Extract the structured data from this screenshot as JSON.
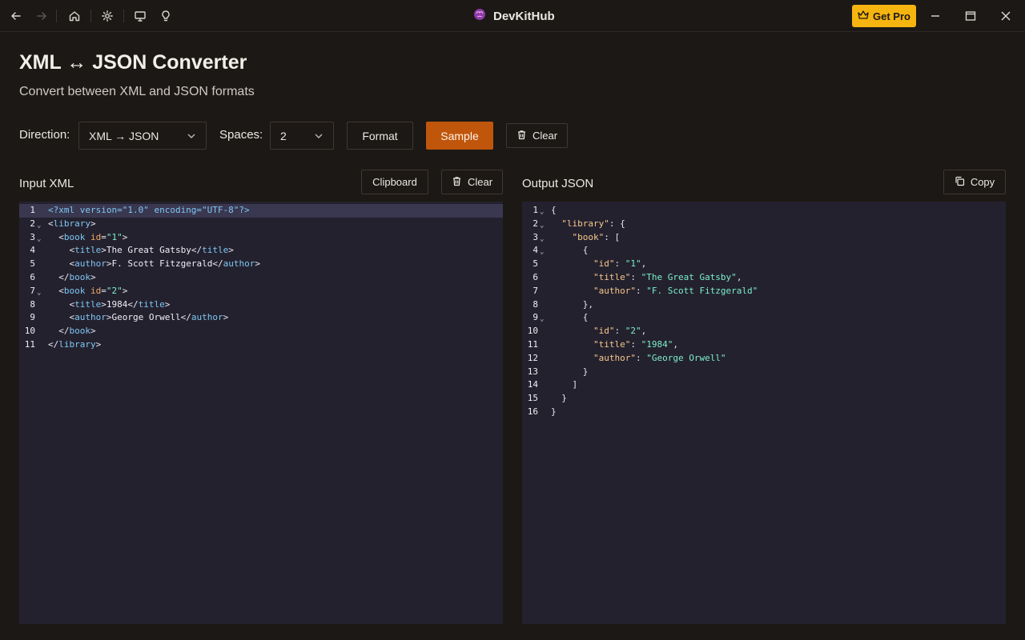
{
  "app": {
    "title": "DevKitHub",
    "get_pro": "Get Pro"
  },
  "page": {
    "title": "XML ↔ JSON Converter",
    "subtitle": "Convert between XML and JSON formats"
  },
  "controls": {
    "direction_label": "Direction:",
    "direction_value": "XML → JSON",
    "spaces_label": "Spaces:",
    "spaces_value": "2",
    "format": "Format",
    "sample": "Sample",
    "clear": "Clear"
  },
  "input": {
    "label": "Input XML",
    "clipboard": "Clipboard",
    "clear": "Clear",
    "lines": [
      {
        "n": "1",
        "fold": false,
        "active": true,
        "segs": [
          {
            "c": "c-pi",
            "t": "<?xml version=\"1.0\" encoding=\"UTF-8\"?>"
          }
        ]
      },
      {
        "n": "2",
        "fold": true,
        "segs": [
          {
            "c": "c-p",
            "t": "<"
          },
          {
            "c": "c-tag",
            "t": "library"
          },
          {
            "c": "c-p",
            "t": ">"
          }
        ]
      },
      {
        "n": "3",
        "fold": true,
        "segs": [
          {
            "c": "c-p",
            "t": "  <"
          },
          {
            "c": "c-tag",
            "t": "book"
          },
          {
            "c": "c-p",
            "t": " "
          },
          {
            "c": "c-attr",
            "t": "id"
          },
          {
            "c": "c-p",
            "t": "="
          },
          {
            "c": "c-str",
            "t": "\"1\""
          },
          {
            "c": "c-p",
            "t": ">"
          }
        ]
      },
      {
        "n": "4",
        "segs": [
          {
            "c": "c-p",
            "t": "    <"
          },
          {
            "c": "c-tag",
            "t": "title"
          },
          {
            "c": "c-p",
            "t": ">"
          },
          {
            "c": "c-text",
            "t": "The Great Gatsby"
          },
          {
            "c": "c-p",
            "t": "</"
          },
          {
            "c": "c-tag",
            "t": "title"
          },
          {
            "c": "c-p",
            "t": ">"
          }
        ]
      },
      {
        "n": "5",
        "segs": [
          {
            "c": "c-p",
            "t": "    <"
          },
          {
            "c": "c-tag",
            "t": "author"
          },
          {
            "c": "c-p",
            "t": ">"
          },
          {
            "c": "c-text",
            "t": "F. Scott Fitzgerald"
          },
          {
            "c": "c-p",
            "t": "</"
          },
          {
            "c": "c-tag",
            "t": "author"
          },
          {
            "c": "c-p",
            "t": ">"
          }
        ]
      },
      {
        "n": "6",
        "segs": [
          {
            "c": "c-p",
            "t": "  </"
          },
          {
            "c": "c-tag",
            "t": "book"
          },
          {
            "c": "c-p",
            "t": ">"
          }
        ]
      },
      {
        "n": "7",
        "fold": true,
        "segs": [
          {
            "c": "c-p",
            "t": "  <"
          },
          {
            "c": "c-tag",
            "t": "book"
          },
          {
            "c": "c-p",
            "t": " "
          },
          {
            "c": "c-attr",
            "t": "id"
          },
          {
            "c": "c-p",
            "t": "="
          },
          {
            "c": "c-str",
            "t": "\"2\""
          },
          {
            "c": "c-p",
            "t": ">"
          }
        ]
      },
      {
        "n": "8",
        "segs": [
          {
            "c": "c-p",
            "t": "    <"
          },
          {
            "c": "c-tag",
            "t": "title"
          },
          {
            "c": "c-p",
            "t": ">"
          },
          {
            "c": "c-text",
            "t": "1984"
          },
          {
            "c": "c-p",
            "t": "</"
          },
          {
            "c": "c-tag",
            "t": "title"
          },
          {
            "c": "c-p",
            "t": ">"
          }
        ]
      },
      {
        "n": "9",
        "segs": [
          {
            "c": "c-p",
            "t": "    <"
          },
          {
            "c": "c-tag",
            "t": "author"
          },
          {
            "c": "c-p",
            "t": ">"
          },
          {
            "c": "c-text",
            "t": "George Orwell"
          },
          {
            "c": "c-p",
            "t": "</"
          },
          {
            "c": "c-tag",
            "t": "author"
          },
          {
            "c": "c-p",
            "t": ">"
          }
        ]
      },
      {
        "n": "10",
        "segs": [
          {
            "c": "c-p",
            "t": "  </"
          },
          {
            "c": "c-tag",
            "t": "book"
          },
          {
            "c": "c-p",
            "t": ">"
          }
        ]
      },
      {
        "n": "11",
        "segs": [
          {
            "c": "c-p",
            "t": "</"
          },
          {
            "c": "c-tag",
            "t": "library"
          },
          {
            "c": "c-p",
            "t": ">"
          }
        ]
      }
    ]
  },
  "output": {
    "label": "Output JSON",
    "copy": "Copy",
    "lines": [
      {
        "n": "1",
        "fold": true,
        "segs": [
          {
            "c": "c-p",
            "t": "{"
          }
        ]
      },
      {
        "n": "2",
        "fold": true,
        "segs": [
          {
            "c": "c-p",
            "t": "  "
          },
          {
            "c": "c-key",
            "t": "\"library\""
          },
          {
            "c": "c-p",
            "t": ": {"
          }
        ]
      },
      {
        "n": "3",
        "fold": true,
        "segs": [
          {
            "c": "c-p",
            "t": "    "
          },
          {
            "c": "c-key",
            "t": "\"book\""
          },
          {
            "c": "c-p",
            "t": ": ["
          }
        ]
      },
      {
        "n": "4",
        "fold": true,
        "segs": [
          {
            "c": "c-p",
            "t": "      {"
          }
        ]
      },
      {
        "n": "5",
        "segs": [
          {
            "c": "c-p",
            "t": "        "
          },
          {
            "c": "c-key",
            "t": "\"id\""
          },
          {
            "c": "c-p",
            "t": ": "
          },
          {
            "c": "c-str",
            "t": "\"1\""
          },
          {
            "c": "c-p",
            "t": ","
          }
        ]
      },
      {
        "n": "6",
        "segs": [
          {
            "c": "c-p",
            "t": "        "
          },
          {
            "c": "c-key",
            "t": "\"title\""
          },
          {
            "c": "c-p",
            "t": ": "
          },
          {
            "c": "c-str",
            "t": "\"The Great Gatsby\""
          },
          {
            "c": "c-p",
            "t": ","
          }
        ]
      },
      {
        "n": "7",
        "segs": [
          {
            "c": "c-p",
            "t": "        "
          },
          {
            "c": "c-key",
            "t": "\"author\""
          },
          {
            "c": "c-p",
            "t": ": "
          },
          {
            "c": "c-str",
            "t": "\"F. Scott Fitzgerald\""
          }
        ]
      },
      {
        "n": "8",
        "segs": [
          {
            "c": "c-p",
            "t": "      },"
          }
        ]
      },
      {
        "n": "9",
        "fold": true,
        "segs": [
          {
            "c": "c-p",
            "t": "      {"
          }
        ]
      },
      {
        "n": "10",
        "segs": [
          {
            "c": "c-p",
            "t": "        "
          },
          {
            "c": "c-key",
            "t": "\"id\""
          },
          {
            "c": "c-p",
            "t": ": "
          },
          {
            "c": "c-str",
            "t": "\"2\""
          },
          {
            "c": "c-p",
            "t": ","
          }
        ]
      },
      {
        "n": "11",
        "segs": [
          {
            "c": "c-p",
            "t": "        "
          },
          {
            "c": "c-key",
            "t": "\"title\""
          },
          {
            "c": "c-p",
            "t": ": "
          },
          {
            "c": "c-str",
            "t": "\"1984\""
          },
          {
            "c": "c-p",
            "t": ","
          }
        ]
      },
      {
        "n": "12",
        "segs": [
          {
            "c": "c-p",
            "t": "        "
          },
          {
            "c": "c-key",
            "t": "\"author\""
          },
          {
            "c": "c-p",
            "t": ": "
          },
          {
            "c": "c-str",
            "t": "\"George Orwell\""
          }
        ]
      },
      {
        "n": "13",
        "segs": [
          {
            "c": "c-p",
            "t": "      }"
          }
        ]
      },
      {
        "n": "14",
        "segs": [
          {
            "c": "c-p",
            "t": "    ]"
          }
        ]
      },
      {
        "n": "15",
        "segs": [
          {
            "c": "c-p",
            "t": "  }"
          }
        ]
      },
      {
        "n": "16",
        "segs": [
          {
            "c": "c-p",
            "t": "}"
          }
        ]
      }
    ]
  },
  "colors": {
    "accent": "#c0560c",
    "pro": "#f5b40f",
    "editor_bg": "#24212f"
  }
}
